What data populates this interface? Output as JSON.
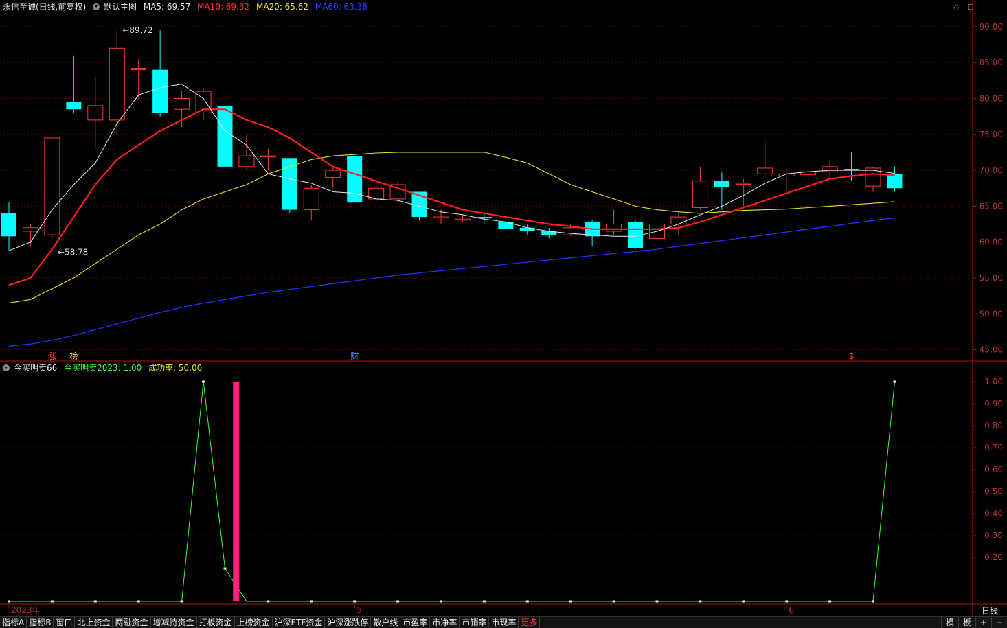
{
  "main_header": {
    "stock": "永信至诚(日线,前复权)",
    "main_label": "默认主图",
    "ma5": "MA5: 69.57",
    "ma10": "MA10: 69.32",
    "ma20": "MA20: 65.62",
    "ma60": "MA60: 63.38"
  },
  "sub_header": {
    "indicator": "今买明卖66",
    "value": "今买明卖2023: 1.00",
    "success": "成功率: 50.00"
  },
  "colors": {
    "up": "#ff3b3b",
    "down": "#00ffff",
    "ma5": "#e8e8e8",
    "ma10": "#ff2020",
    "ma20": "#e8e030",
    "ma60": "#2030ff",
    "axis": "#b01010",
    "sub_line": "#40ff40",
    "bar": "#ff2080"
  },
  "chart_data": [
    {
      "type": "candlestick",
      "ylim": [
        44,
        92
      ],
      "y_ticks": [
        45.0,
        50.0,
        55.0,
        60.0,
        65.0,
        70.0,
        75.0,
        80.0,
        85.0,
        90.0
      ],
      "y_tick_labels": [
        "45.00",
        "50.00",
        "55.00",
        "60.00",
        "65.00",
        "70.00",
        "75.00",
        "80.00",
        "85.00",
        "90.00"
      ],
      "ohlc": [
        [
          64.0,
          65.5,
          58.8,
          60.8
        ],
        [
          61.5,
          62.5,
          59.5,
          62.0
        ],
        [
          61.0,
          74.5,
          60.5,
          74.5
        ],
        [
          79.5,
          86.0,
          78.0,
          78.5
        ],
        [
          77.0,
          83.0,
          73.0,
          79.0
        ],
        [
          77.0,
          89.7,
          75.0,
          87.0
        ],
        [
          84.0,
          85.5,
          80.0,
          84.2
        ],
        [
          84.0,
          89.5,
          77.5,
          78.0
        ],
        [
          78.5,
          81.0,
          76.0,
          80.0
        ],
        [
          78.0,
          81.5,
          77.0,
          81.0
        ],
        [
          79.0,
          79.0,
          70.0,
          70.5
        ],
        [
          70.5,
          75.0,
          70.0,
          72.0
        ],
        [
          72.0,
          73.0,
          70.0,
          72.0
        ],
        [
          71.7,
          71.7,
          64.0,
          64.5
        ],
        [
          64.5,
          68.0,
          63.0,
          67.5
        ],
        [
          69.0,
          70.5,
          67.5,
          70.0
        ],
        [
          72.0,
          72.0,
          65.5,
          65.5
        ],
        [
          66.0,
          69.0,
          65.5,
          67.5
        ],
        [
          66.0,
          68.5,
          65.5,
          68.0
        ],
        [
          67.0,
          67.0,
          63.0,
          63.5
        ],
        [
          63.5,
          64.5,
          62.5,
          63.5
        ],
        [
          63.2,
          63.8,
          62.8,
          63.2
        ],
        [
          63.5,
          64.0,
          62.5,
          63.3
        ],
        [
          62.8,
          63.3,
          61.5,
          61.8
        ],
        [
          62.0,
          62.5,
          61.0,
          61.5
        ],
        [
          61.5,
          62.0,
          60.5,
          61.0
        ],
        [
          61.0,
          62.5,
          60.8,
          62.0
        ],
        [
          62.8,
          63.0,
          59.5,
          60.8
        ],
        [
          61.5,
          64.5,
          61.0,
          62.5
        ],
        [
          62.8,
          63.0,
          59.0,
          59.2
        ],
        [
          60.5,
          63.5,
          59.0,
          62.5
        ],
        [
          62.5,
          64.0,
          61.0,
          63.5
        ],
        [
          64.8,
          70.5,
          64.5,
          68.5
        ],
        [
          68.5,
          69.8,
          64.5,
          67.7
        ],
        [
          68.2,
          68.8,
          65.0,
          68.2
        ],
        [
          69.5,
          74.0,
          69.0,
          70.3
        ],
        [
          69.2,
          70.5,
          67.0,
          69.5
        ],
        [
          69.4,
          69.8,
          68.5,
          69.8
        ],
        [
          69.8,
          71.5,
          69.0,
          70.5
        ],
        [
          70.2,
          72.5,
          68.5,
          70.0
        ],
        [
          67.8,
          70.5,
          67.0,
          70.3
        ],
        [
          69.5,
          70.5,
          67.0,
          67.5
        ]
      ],
      "ma5": [
        58.8,
        60.0,
        64.5,
        68.0,
        71.0,
        76.5,
        80.5,
        81.5,
        82.0,
        80.0,
        75.5,
        73.5,
        69.5,
        68.8,
        68.2,
        67.0,
        66.8,
        66.0,
        65.8,
        65.0,
        64.2,
        63.8,
        63.2,
        62.8,
        62.0,
        61.5,
        61.2,
        61.0,
        60.8,
        60.8,
        61.5,
        62.5,
        63.8,
        65.0,
        66.5,
        68.2,
        69.5,
        69.8,
        70.0,
        70.0,
        70.0,
        69.57
      ],
      "ma10": [
        54.0,
        55.0,
        59.0,
        63.5,
        68.0,
        71.5,
        73.5,
        75.5,
        77.0,
        78.5,
        78.5,
        77.0,
        76.0,
        74.5,
        72.5,
        70.5,
        69.5,
        68.5,
        67.5,
        66.5,
        65.5,
        64.5,
        64.0,
        63.5,
        63.0,
        62.5,
        62.2,
        61.8,
        61.8,
        61.8,
        61.8,
        62.0,
        62.8,
        63.8,
        64.8,
        65.8,
        66.8,
        67.8,
        68.8,
        69.2,
        69.5,
        69.32
      ],
      "ma20": [
        51.5,
        52.0,
        53.5,
        55.0,
        57.0,
        59.0,
        61.0,
        62.5,
        64.5,
        66.0,
        67.0,
        68.0,
        69.5,
        70.5,
        71.5,
        72.0,
        72.2,
        72.4,
        72.5,
        72.5,
        72.5,
        72.5,
        72.5,
        71.8,
        71.0,
        69.5,
        68.0,
        67.0,
        66.0,
        65.0,
        64.5,
        64.2,
        64.0,
        64.2,
        64.4,
        64.5,
        64.6,
        64.8,
        65.0,
        65.2,
        65.4,
        65.62
      ],
      "ma60": [
        45.5,
        45.8,
        46.3,
        47.0,
        47.8,
        48.6,
        49.4,
        50.2,
        50.9,
        51.5,
        52.0,
        52.5,
        53.0,
        53.4,
        53.8,
        54.2,
        54.6,
        55.0,
        55.4,
        55.7,
        56.0,
        56.3,
        56.6,
        56.9,
        57.2,
        57.5,
        57.8,
        58.1,
        58.4,
        58.7,
        59.0,
        59.4,
        59.8,
        60.2,
        60.6,
        61.0,
        61.4,
        61.8,
        62.2,
        62.6,
        63.0,
        63.38
      ],
      "annotations": [
        {
          "text": "89.72",
          "index": 5,
          "price": 89.72
        },
        {
          "text": "58.78",
          "index": 2,
          "price": 58.78
        }
      ],
      "markers": [
        {
          "text": "涨",
          "index": 2,
          "color": "#ff3b3b"
        },
        {
          "text": "榜",
          "index": 3,
          "color": "#ffd040"
        },
        {
          "text": "财",
          "index": 16,
          "color": "#4090ff"
        },
        {
          "text": "$",
          "index": 39,
          "color": "#ff3b3b"
        }
      ],
      "x_labels": [
        {
          "text": "2023年",
          "index": 0
        },
        {
          "text": "5",
          "index": 16
        },
        {
          "text": "6",
          "index": 36
        }
      ]
    },
    {
      "type": "line",
      "ylim": [
        0,
        1.05
      ],
      "y_ticks": [
        0.2,
        0.3,
        0.4,
        0.5,
        0.6,
        0.7,
        0.8,
        0.9,
        1.0
      ],
      "y_tick_labels": [
        "0.20",
        "0.30",
        "0.40",
        "0.50",
        "0.60",
        "0.70",
        "0.80",
        "0.90",
        "1.00"
      ],
      "series": [
        {
          "values": [
            0,
            0,
            0,
            0,
            0,
            0,
            0,
            0,
            0,
            1,
            0.15,
            0,
            0,
            0,
            0,
            0,
            0,
            0,
            0,
            0,
            0,
            0,
            0,
            0,
            0,
            0,
            0,
            0,
            0,
            0,
            0,
            0,
            0,
            0,
            0,
            0,
            0,
            0,
            0,
            0,
            0,
            1
          ]
        }
      ],
      "bar_index": 10.5
    }
  ],
  "period_label": "日线",
  "toolbar": [
    "指标A",
    "指标B",
    "窗口",
    "北上资金",
    "两融资金",
    "增减持资金",
    "打板资金",
    "上榜资金",
    "沪深ETF资金",
    "沪深涨跌停",
    "散户线",
    "市盈率",
    "市净率",
    "市销率",
    "市现率",
    "更多"
  ],
  "toolbar_right": [
    "模",
    "板",
    "+",
    "−"
  ],
  "top_icons": [
    "◇",
    "☐"
  ]
}
